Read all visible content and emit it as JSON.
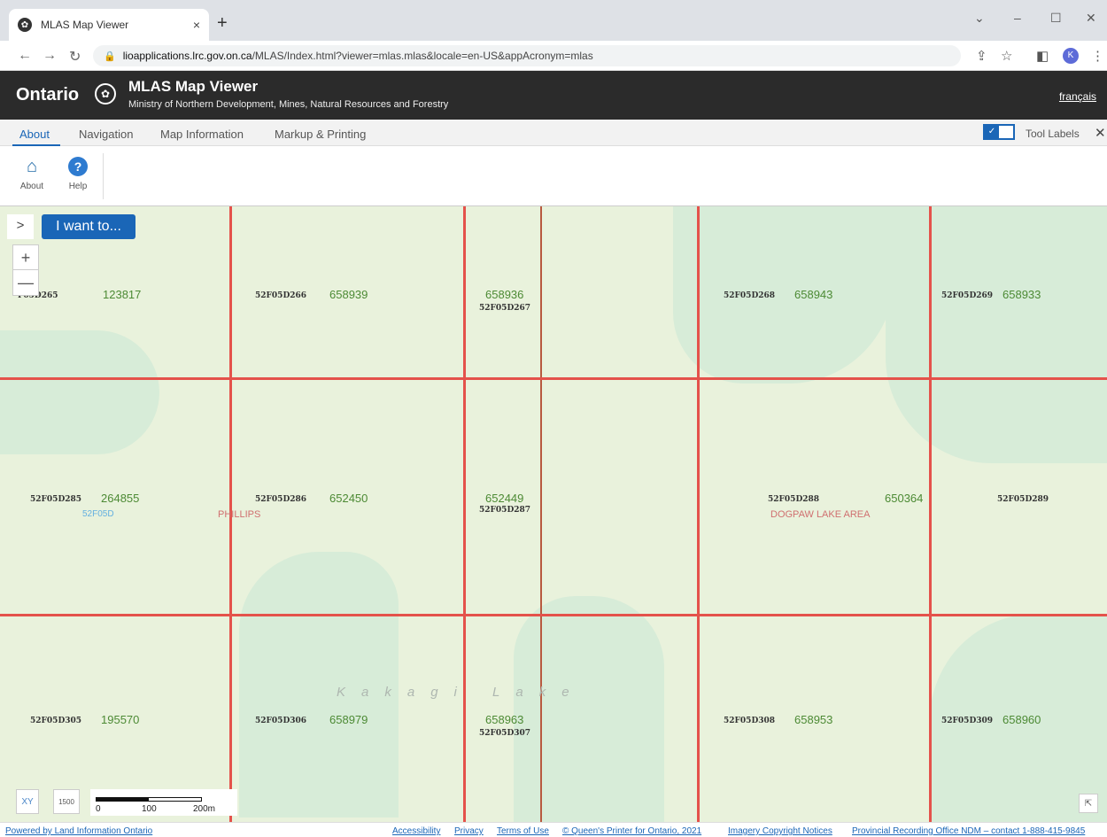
{
  "browser": {
    "tab_title": "MLAS Map Viewer",
    "tab_close": "×",
    "new_tab": "+",
    "url_host": "lioapplications.lrc.gov.on.ca",
    "url_path": "/MLAS/Index.html?viewer=mlas.mlas&locale=en-US&appAcronym=mlas",
    "profile_initial": "K"
  },
  "header": {
    "brand": "Ontario",
    "title": "MLAS Map Viewer",
    "subtitle": "Ministry of Northern Development, Mines, Natural Resources and Forestry",
    "language_link": "français"
  },
  "toolbar": {
    "tabs": [
      "About",
      "Navigation",
      "Map Information",
      "Markup & Printing"
    ],
    "tool_labels": "Tool Labels",
    "ribbon": {
      "about_label": "About",
      "help_label": "Help"
    }
  },
  "map": {
    "i_want_to": "I want to...",
    "zoom_in": "+",
    "zoom_out": "—",
    "cells": [
      {
        "id": "F05D265",
        "num": "123817"
      },
      {
        "id": "52F05D266",
        "num": "658939"
      },
      {
        "id": "52F05D267",
        "num": "658936"
      },
      {
        "id": "52F05D268",
        "num": "658943"
      },
      {
        "id": "52F05D269",
        "num": "658933"
      },
      {
        "id": "52F05D285",
        "num": "264855"
      },
      {
        "id": "52F05D286",
        "num": "652450"
      },
      {
        "id": "52F05D287",
        "num": "652449"
      },
      {
        "id": "52F05D288",
        "num": "650364"
      },
      {
        "id": "52F05D289",
        "num": ""
      },
      {
        "id": "52F05D305",
        "num": "195570"
      },
      {
        "id": "52F05D306",
        "num": "658979"
      },
      {
        "id": "52F05D307",
        "num": "658963"
      },
      {
        "id": "52F05D308",
        "num": "658953"
      },
      {
        "id": "52F05D309",
        "num": "658960"
      }
    ],
    "grid_label": "52F05D",
    "area_phillips": "PHILLIPS",
    "area_dogpaw": "DOGPAW LAKE AREA",
    "lake_label": "Kakagi Lake",
    "scale_labels": [
      "0",
      "100",
      "200m"
    ],
    "scale_button": "1500"
  },
  "footer": {
    "powered": "Powered by Land Information Ontario",
    "accessibility": "Accessibility",
    "privacy": "Privacy",
    "terms": "Terms of Use",
    "copyright": "© Queen's Printer for Ontario, 2021",
    "imagery": "Imagery Copyright Notices",
    "recording": "Provincial Recording Office NDM – contact 1-888-415-9845"
  }
}
